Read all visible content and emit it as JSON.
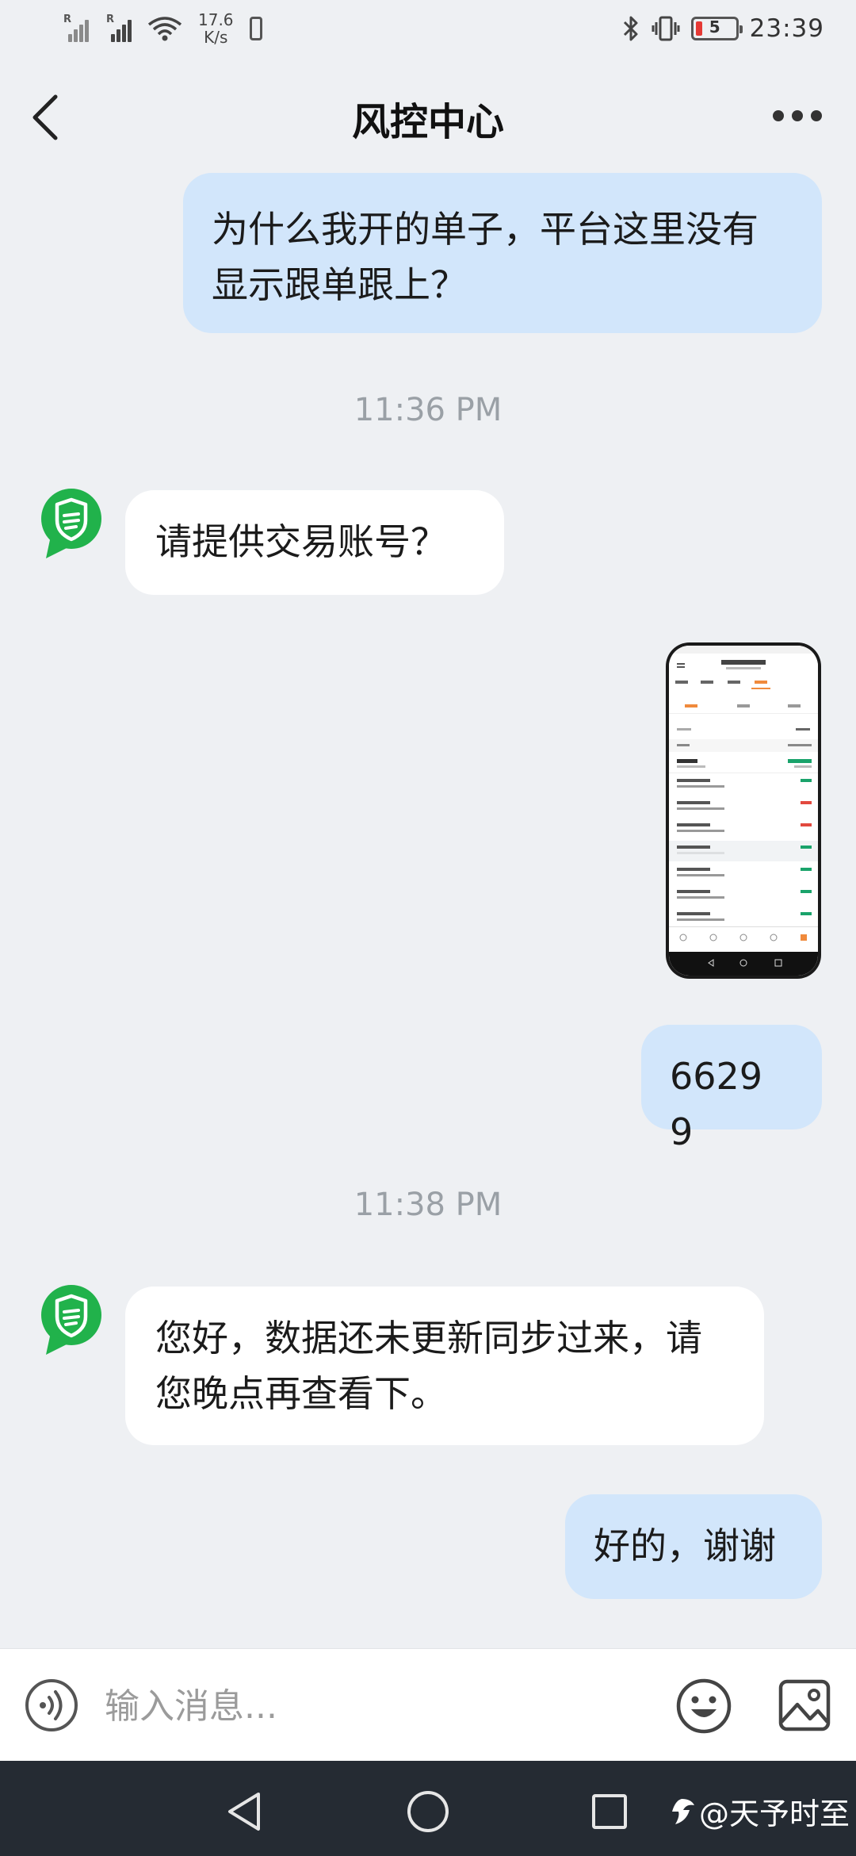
{
  "status_bar": {
    "signal_1_label": "R",
    "signal_2_label": "R",
    "speed_value": "17.6",
    "speed_unit": "K/s",
    "battery_level": "5",
    "time": "23:39"
  },
  "header": {
    "title": "风控中心"
  },
  "messages": [
    {
      "side": "right",
      "text": "为什么我开的单子，平台这里没有显示跟单跟上？"
    },
    {
      "type": "time",
      "text": "11:36 PM"
    },
    {
      "side": "left",
      "text": "请提供交易账号？"
    },
    {
      "side": "right",
      "type": "image",
      "content": "screenshot"
    },
    {
      "side": "right",
      "text": "6629 9"
    },
    {
      "type": "time",
      "text": "11:38 PM"
    },
    {
      "side": "left",
      "text": "您好，数据还未更新同步过来，请您晚点再查看下。"
    },
    {
      "side": "right",
      "text": "好的，谢谢"
    }
  ],
  "composer": {
    "placeholder": "输入消息..."
  },
  "watermark": {
    "text": "@天予时至"
  },
  "colors": {
    "background": "#eef0f3",
    "bubble_sent": "#d2e6fb",
    "bubble_received": "#ffffff",
    "avatar_green": "#21b24b",
    "nav_bar": "#252b33"
  },
  "icons": [
    "back-icon",
    "more-icon",
    "bot-avatar-icon",
    "voice-icon",
    "emoji-icon",
    "image-icon",
    "nav-back-icon",
    "nav-home-icon",
    "nav-recent-icon"
  ]
}
